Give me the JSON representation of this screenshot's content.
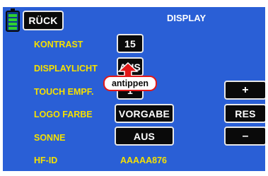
{
  "header": {
    "back_label": "RÜCK",
    "title": "DISPLAY"
  },
  "rows": [
    {
      "label": "KONTRAST",
      "value": "15"
    },
    {
      "label": "DISPLAYLICHT",
      "value": "AUS"
    },
    {
      "label": "TOUCH EMPF.",
      "value": "1"
    },
    {
      "label": "LOGO FARBE",
      "value": "VORGABE"
    },
    {
      "label": "SONNE",
      "value": "AUS"
    },
    {
      "label": "HF-ID",
      "value": "AAAAA876"
    }
  ],
  "side_buttons": {
    "plus": "+",
    "reset": "RES",
    "minus": "–"
  },
  "callout": {
    "text": "antippen"
  },
  "colors": {
    "background": "#2a5fd6",
    "label_yellow": "#f5e000",
    "callout_red": "#e21818",
    "battery_green": "#2fd12f"
  },
  "icons": {
    "battery": "battery-icon",
    "arrow": "arrow-up-icon"
  }
}
